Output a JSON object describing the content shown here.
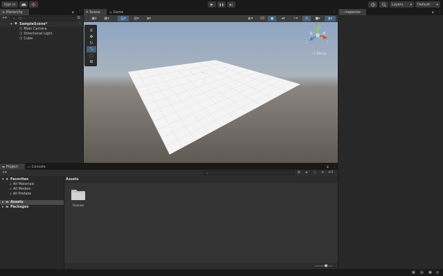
{
  "toolbar": {
    "sign_in": "Sign in",
    "layers": "Layers",
    "layout": "Default",
    "play_icon": "▶",
    "pause_icon": "❚❚",
    "step_icon": "▶|"
  },
  "hierarchy": {
    "tab": "Hierarchy",
    "search_placeholder": "All",
    "scene": "SampleScene*",
    "items": [
      "Main Camera",
      "Directional Light",
      "Cube"
    ]
  },
  "scene_view": {
    "tabs": [
      "Scene",
      "Game"
    ],
    "mode_2d": "2D",
    "persp": "< Persp",
    "gizmo_axes": {
      "x": "x",
      "y": "y",
      "z": "z"
    }
  },
  "inspector": {
    "tab": "Inspector"
  },
  "project": {
    "tabs": [
      "Project",
      "Console"
    ],
    "favorites": "Favorites",
    "favorite_items": [
      "All Materials",
      "All Models",
      "All Prefabs"
    ],
    "roots": [
      "Assets",
      "Packages"
    ],
    "breadcrumb": "Assets",
    "folder": "Scenes",
    "hidden_count": "4"
  },
  "colors": {
    "accent": "#46607c",
    "sky_top": "#8fa4c0",
    "ground": "#6a635c"
  }
}
